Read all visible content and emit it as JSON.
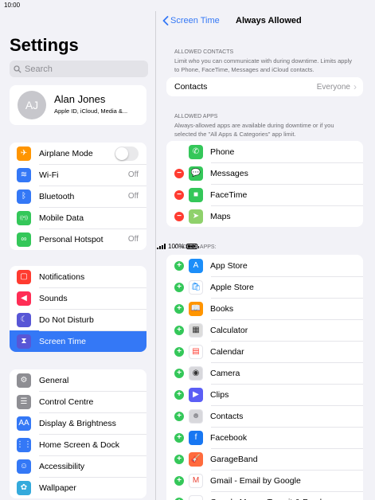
{
  "status": {
    "time": "10:00",
    "battery": "100%",
    "battery_level": 1.0
  },
  "left": {
    "title": "Settings",
    "search_placeholder": "Search",
    "profile": {
      "initials": "AJ",
      "name": "Alan Jones",
      "subtitle": "Apple ID, iCloud, Media &..."
    },
    "group1": [
      {
        "label": "Airplane Mode",
        "icon": "airplane-icon",
        "color": "#ff9500",
        "glyph": "✈",
        "toggle": true
      },
      {
        "label": "Wi-Fi",
        "icon": "wifi-icon",
        "color": "#3478f6",
        "glyph": "≋",
        "value": "Off"
      },
      {
        "label": "Bluetooth",
        "icon": "bluetooth-icon",
        "color": "#3478f6",
        "glyph": "ᛒ",
        "value": "Off"
      },
      {
        "label": "Mobile Data",
        "icon": "antenna-icon",
        "color": "#34c759",
        "glyph": "((•))",
        "value": ""
      },
      {
        "label": "Personal Hotspot",
        "icon": "hotspot-icon",
        "color": "#34c759",
        "glyph": "∞",
        "value": "Off"
      }
    ],
    "group2": [
      {
        "label": "Notifications",
        "icon": "notifications-icon",
        "color": "#ff3b30",
        "glyph": "▢"
      },
      {
        "label": "Sounds",
        "icon": "speaker-icon",
        "color": "#ff2d55",
        "glyph": "◀"
      },
      {
        "label": "Do Not Disturb",
        "icon": "moon-icon",
        "color": "#5856d6",
        "glyph": "☾"
      },
      {
        "label": "Screen Time",
        "icon": "hourglass-icon",
        "color": "#5856d6",
        "glyph": "⧗",
        "selected": true
      }
    ],
    "group3": [
      {
        "label": "General",
        "icon": "gear-icon",
        "color": "#8e8e93",
        "glyph": "⚙"
      },
      {
        "label": "Control Centre",
        "icon": "switches-icon",
        "color": "#8e8e93",
        "glyph": "☰"
      },
      {
        "label": "Display & Brightness",
        "icon": "display-icon",
        "color": "#3478f6",
        "glyph": "AA"
      },
      {
        "label": "Home Screen & Dock",
        "icon": "grid-icon",
        "color": "#3478f6",
        "glyph": "⋮⋮"
      },
      {
        "label": "Accessibility",
        "icon": "accessibility-icon",
        "color": "#3478f6",
        "glyph": "☺"
      },
      {
        "label": "Wallpaper",
        "icon": "flower-icon",
        "color": "#34aadc",
        "glyph": "✿"
      }
    ]
  },
  "right": {
    "back_label": "Screen Time",
    "title": "Always Allowed",
    "contacts_header": "ALLOWED CONTACTS",
    "contacts_desc": "Limit who you can communicate with during downtime. Limits apply to Phone, FaceTime, Messages and iCloud contacts.",
    "contacts_row": {
      "label": "Contacts",
      "value": "Everyone"
    },
    "apps_header": "ALLOWED APPS",
    "apps_desc": "Always-allowed apps are available during downtime or if you selected the \"All Apps & Categories\" app limit.",
    "allowed_apps": [
      {
        "label": "Phone",
        "icon": "phone-icon",
        "color": "#34c759",
        "glyph": "✆",
        "mark": "none"
      },
      {
        "label": "Messages",
        "icon": "messages-icon",
        "color": "#34c759",
        "glyph": "💬",
        "mark": "minus"
      },
      {
        "label": "FaceTime",
        "icon": "facetime-icon",
        "color": "#34c759",
        "glyph": "■",
        "mark": "minus"
      },
      {
        "label": "Maps",
        "icon": "maps-icon",
        "color": "#8fd16b",
        "glyph": "➤",
        "mark": "minus"
      }
    ],
    "choose_header": "CHOOSE APPS:",
    "choose_apps": [
      {
        "label": "App Store",
        "icon": "app-store-icon",
        "color": "#1c8ef9",
        "glyph": "A"
      },
      {
        "label": "Apple Store",
        "icon": "apple-store-icon",
        "color": "#ffffff",
        "glyph": "🛍",
        "fg": "#1c8ef9"
      },
      {
        "label": "Books",
        "icon": "books-icon",
        "color": "#ff9500",
        "glyph": "📖"
      },
      {
        "label": "Calculator",
        "icon": "calculator-icon",
        "color": "#dcdcdc",
        "glyph": "▦",
        "fg": "#333333"
      },
      {
        "label": "Calendar",
        "icon": "calendar-icon",
        "color": "#ffffff",
        "glyph": "▤",
        "fg": "#ff3b30"
      },
      {
        "label": "Camera",
        "icon": "camera-icon",
        "color": "#d8d8dc",
        "glyph": "◉",
        "fg": "#333333"
      },
      {
        "label": "Clips",
        "icon": "clips-icon",
        "color": "#5b5ef5",
        "glyph": "▶"
      },
      {
        "label": "Contacts",
        "icon": "contacts-icon",
        "color": "#d8d8dc",
        "glyph": "☻",
        "fg": "#8e8e93"
      },
      {
        "label": "Facebook",
        "icon": "facebook-icon",
        "color": "#1877f2",
        "glyph": "f"
      },
      {
        "label": "GarageBand",
        "icon": "garageband-icon",
        "color": "#ff6b3d",
        "glyph": "🎸"
      },
      {
        "label": "Gmail - Email by Google",
        "icon": "gmail-icon",
        "color": "#ffffff",
        "glyph": "M",
        "fg": "#ea4335"
      },
      {
        "label": "Google Maps - Transit & Food",
        "icon": "google-maps-icon",
        "color": "#ffffff",
        "glyph": "●",
        "fg": "#4285f4"
      }
    ]
  }
}
